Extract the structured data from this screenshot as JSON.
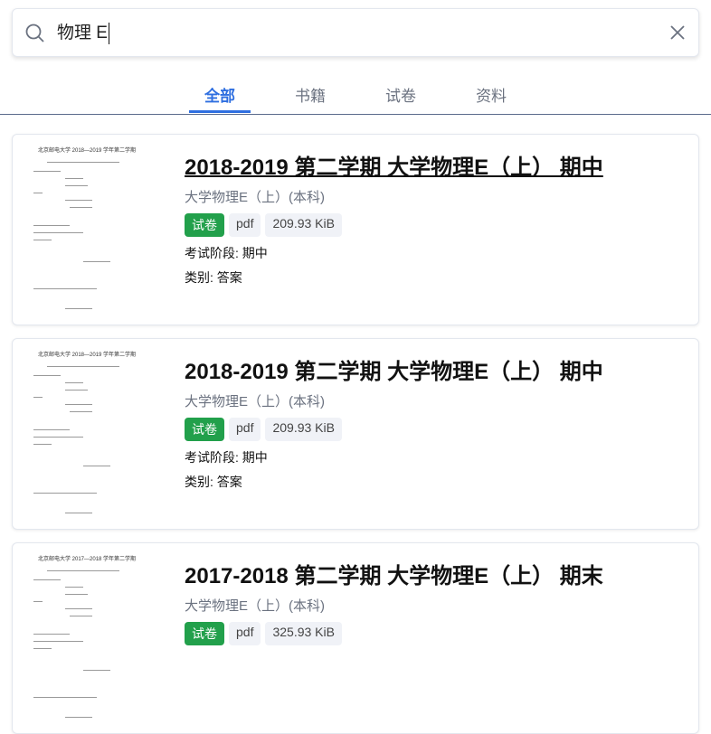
{
  "search": {
    "value": "物理 E",
    "icons": [
      "search-icon",
      "close-icon"
    ]
  },
  "tabs": [
    {
      "label": "全部",
      "active": true
    },
    {
      "label": "书籍"
    },
    {
      "label": "试卷"
    },
    {
      "label": "资料"
    }
  ],
  "results": [
    {
      "title": "2018-2019 第二学期 大学物理E（上） 期中",
      "course": "大学物理E（上）(本科)",
      "type": "试卷",
      "format": "pdf",
      "size": "209.93 KiB",
      "stage": "考试阶段: 期中",
      "category": "类别: 答案",
      "thumb_text": "北京邮电大学 2018—2019 学年第二学期"
    },
    {
      "title": "2018-2019 第二学期 大学物理E（上） 期中",
      "course": "大学物理E（上）(本科)",
      "type": "试卷",
      "format": "pdf",
      "size": "209.93 KiB",
      "stage": "考试阶段: 期中",
      "category": "类别: 答案",
      "thumb_text": "北京邮电大学 2018—2019 学年第二学期"
    },
    {
      "title": "2017-2018 第二学期 大学物理E（上） 期末",
      "course": "大学物理E（上）(本科)",
      "type": "试卷",
      "format": "pdf",
      "size": "325.93 KiB",
      "thumb_text": "北京邮电大学 2017—2018 学年第二学期"
    }
  ],
  "colors": {
    "accent": "#2f6fe0",
    "badge_green": "#22a04b"
  }
}
